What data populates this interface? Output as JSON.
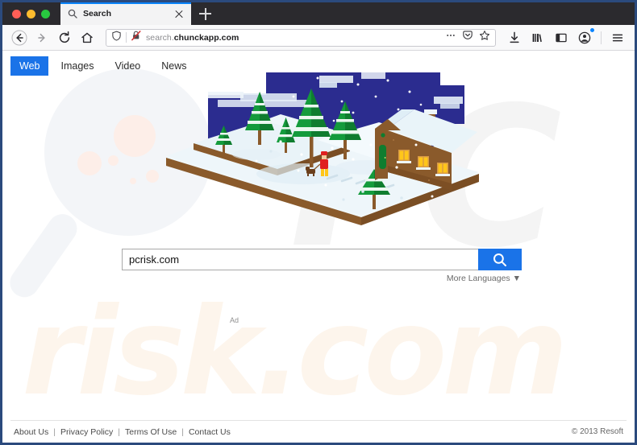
{
  "browser": {
    "window_controls": [
      "close",
      "minimize",
      "maximize"
    ],
    "tab": {
      "title": "Search",
      "favicon": "search-icon",
      "close": "×"
    },
    "new_tab_label": "+",
    "toolbar": {
      "back": "back-arrow",
      "forward": "forward-arrow",
      "reload": "reload-icon",
      "home": "home-icon",
      "downloads": "download-icon",
      "library": "library-icon",
      "sidebar": "sidebar-icon",
      "account": "account-icon",
      "menu": "hamburger-menu-icon"
    },
    "urlbar": {
      "shield": "tracking-protection-shield-icon",
      "connection": "insecure-connection-icon",
      "url_prefix": "search.",
      "url_domain": "chunckapp.com",
      "full_url": "search.chunckapp.com",
      "page_actions": "ellipsis-icon",
      "pocket": "pocket-icon",
      "bookmark": "star-icon"
    }
  },
  "site": {
    "nav": [
      {
        "label": "Web",
        "active": true
      },
      {
        "label": "Images",
        "active": false
      },
      {
        "label": "Video",
        "active": false
      },
      {
        "label": "News",
        "active": false
      }
    ],
    "search": {
      "value": "pcrisk.com",
      "placeholder": "",
      "button_icon": "magnifier-icon",
      "more_languages": "More Languages ▼"
    },
    "ad_label": "Ad",
    "footer": {
      "links": [
        "About Us",
        "Privacy Policy",
        "Terms Of Use",
        "Contact Us"
      ],
      "separator": "|",
      "copyright": "© 2013 Resoft"
    },
    "watermarks": {
      "top": "PC",
      "bottom": "risk.com"
    },
    "illustration": {
      "name": "winter-night-cabin-scene",
      "description": "Isometric snowy landscape at night with pine trees, a lit cabin, a person walking a dog"
    }
  },
  "colors": {
    "accent_blue": "#1a73e8",
    "tab_active_blue": "#0a84ff",
    "window_border": "#2b4a7d",
    "titlebar": "#2b2a2e",
    "toolbar": "#f9f9fa",
    "night_sky": "#2b2c8f",
    "snow": "#eef6fa",
    "tree_green": "#149b3c",
    "cabin_brown": "#8a5a2b",
    "window_light": "#ffc61a",
    "watermark_gray": "#f4f4f4",
    "watermark_cream": "#fdf5ec"
  }
}
